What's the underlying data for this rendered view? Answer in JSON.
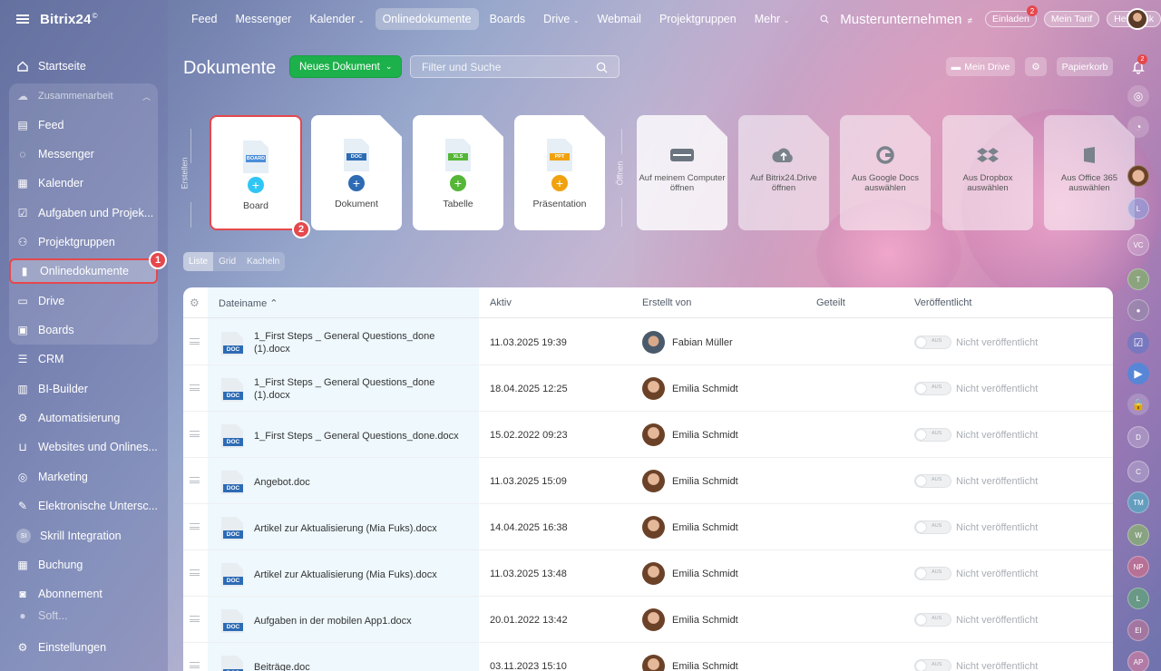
{
  "app": {
    "logo": "Bitrix24",
    "logo_mark": "©"
  },
  "sidebar": {
    "home": "Startseite",
    "group": "Zusammenarbeit",
    "items": [
      "Feed",
      "Messenger",
      "Kalender",
      "Aufgaben und Projek...",
      "Projektgruppen",
      "Onlinedokumente",
      "Drive",
      "Boards"
    ],
    "other": [
      "CRM",
      "BI-Builder",
      "Automatisierung",
      "Websites und Onlines...",
      "Marketing",
      "Elektronische Untersc...",
      "Skrill Integration",
      "Buchung",
      "Abonnement",
      "Soft..."
    ],
    "skrill_badge": "SI",
    "settings": "Einstellungen",
    "step": "1"
  },
  "topnav": {
    "items": [
      "Feed",
      "Messenger",
      "Kalender",
      "Onlinedokumente",
      "Boards",
      "Drive",
      "Webmail",
      "Projektgruppen",
      "Mehr"
    ],
    "company": "Musterunternehmen",
    "company_icon": "≠",
    "invite": "Einladen",
    "invite_badge": "2",
    "tariff": "Mein Tarif",
    "helpdesk": "Helpdesk"
  },
  "toolbar": {
    "title": "Dokumente",
    "new_doc": "Neues Dokument",
    "filter_placeholder": "Filter und Suche",
    "drive": "Mein Drive",
    "trash": "Papierkorb"
  },
  "create": {
    "label": "Erstellen",
    "cards": [
      {
        "label": "Board",
        "tag": "BOARD",
        "tag_color": "#4b8ed8",
        "plus_color": "#2fc6f6"
      },
      {
        "label": "Dokument",
        "tag": "DOC",
        "tag_color": "#2d6bb5",
        "plus_color": "#2d6bb5"
      },
      {
        "label": "Tabelle",
        "tag": "XLS",
        "tag_color": "#55b637",
        "plus_color": "#55b637"
      },
      {
        "label": "Präsentation",
        "tag": "PPT",
        "tag_color": "#f0a20e",
        "plus_color": "#f0a20e"
      }
    ],
    "step": "2"
  },
  "open": {
    "label": "Öffnen",
    "cards": [
      "Auf meinem Computer öffnen",
      "Auf Bitrix24.Drive öffnen",
      "Aus Google Docs auswählen",
      "Aus Dropbox auswählen",
      "Aus Office 365 auswählen"
    ]
  },
  "views": [
    "Liste",
    "Grid",
    "Kacheln"
  ],
  "table": {
    "columns": [
      "Dateiname ⌃",
      "Aktiv",
      "Erstellt von",
      "Geteilt",
      "Veröffentlicht"
    ],
    "toggle_label": "AUS",
    "rows": [
      {
        "name": "1_First Steps _ General Questions_done (1).docx",
        "date": "11.03.2025 19:39",
        "author": "Fabian Müller",
        "status": "Nicht veröffentlicht"
      },
      {
        "name": "1_First Steps _ General Questions_done (1).docx",
        "date": "18.04.2025 12:25",
        "author": "Emilia Schmidt",
        "status": "Nicht veröffentlicht"
      },
      {
        "name": "1_First Steps _ General Questions_done.docx",
        "date": "15.02.2022 09:23",
        "author": "Emilia Schmidt",
        "status": "Nicht veröffentlicht"
      },
      {
        "name": "Angebot.doc",
        "date": "11.03.2025 15:09",
        "author": "Emilia Schmidt",
        "status": "Nicht veröffentlicht"
      },
      {
        "name": "Artikel zur Aktualisierung (Mia Fuks).docx",
        "date": "14.04.2025 16:38",
        "author": "Emilia Schmidt",
        "status": "Nicht veröffentlicht"
      },
      {
        "name": "Artikel zur Aktualisierung (Mia Fuks).docx",
        "date": "11.03.2025 13:48",
        "author": "Emilia Schmidt",
        "status": "Nicht veröffentlicht"
      },
      {
        "name": "Aufgaben in der mobilen App1.docx",
        "date": "20.01.2022 13:42",
        "author": "Emilia Schmidt",
        "status": "Nicht veröffentlicht"
      },
      {
        "name": "Beiträge.doc",
        "date": "03.11.2023 15:10",
        "author": "Emilia Schmidt",
        "status": "Nicht veröffentlicht"
      }
    ]
  },
  "rail": {
    "notif_badge": "2",
    "initials": [
      "VC",
      "T",
      "D",
      "C",
      "TM",
      "W",
      "NP",
      "L",
      "EI",
      "AP"
    ]
  }
}
